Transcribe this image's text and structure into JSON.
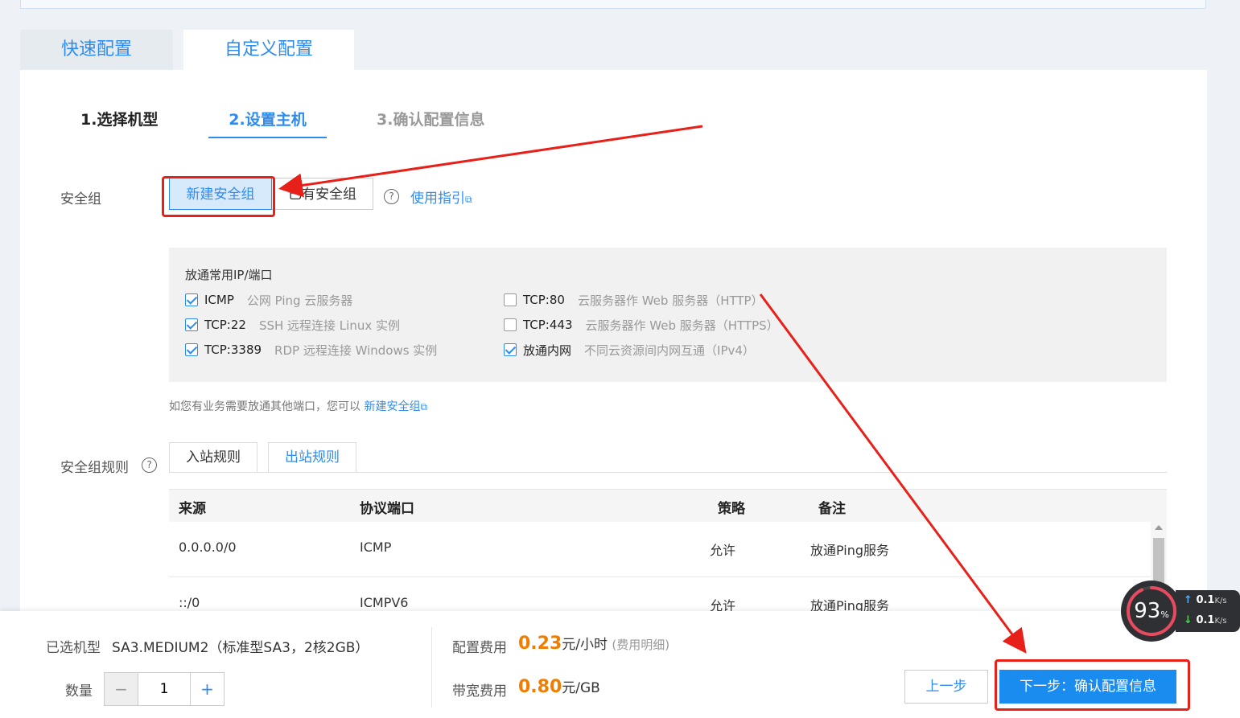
{
  "mode_tabs": {
    "quick": "快速配置",
    "custom": "自定义配置"
  },
  "steps": [
    "1.选择机型",
    "2.设置主机",
    "3.确认配置信息"
  ],
  "security_group": {
    "label": "安全组",
    "new_label": "新建安全组",
    "existing_label": "已有安全组",
    "guide_link": "使用指引"
  },
  "ports": {
    "title": "放通常用IP/端口",
    "items": [
      {
        "name": "ICMP",
        "desc": "公网 Ping 云服务器",
        "checked": true
      },
      {
        "name": "TCP:22",
        "desc": "SSH 远程连接 Linux 实例",
        "checked": true
      },
      {
        "name": "TCP:3389",
        "desc": "RDP 远程连接 Windows 实例",
        "checked": true
      },
      {
        "name": "TCP:80",
        "desc": "云服务器作 Web 服务器（HTTP）",
        "checked": false
      },
      {
        "name": "TCP:443",
        "desc": "云服务器作 Web 服务器（HTTPS）",
        "checked": false
      },
      {
        "name": "放通内网",
        "desc": "不同云资源间内网互通（IPv4）",
        "checked": true
      }
    ]
  },
  "hint": {
    "text": "如您有业务需要放通其他端口，您可以",
    "link": "新建安全组"
  },
  "rules": {
    "label": "安全组规则",
    "tab_in": "入站规则",
    "tab_out": "出站规则",
    "columns": [
      "来源",
      "协议端口",
      "策略",
      "备注"
    ],
    "rows": [
      {
        "source": "0.0.0.0/0",
        "protocol": "ICMP",
        "policy": "允许",
        "note": "放通Ping服务"
      },
      {
        "source": "::/0",
        "protocol": "ICMPV6",
        "policy": "允许",
        "note": "放通Ping服务"
      }
    ]
  },
  "footer": {
    "model_label": "已选机型",
    "model_value": "SA3.MEDIUM2（标准型SA3，2核2GB）",
    "qty_label": "数量",
    "qty_value": "1",
    "config_fee_label": "配置费用",
    "config_fee_price": "0.23",
    "config_fee_unit": "元/小时",
    "config_fee_detail": "(费用明细)",
    "bw_fee_label": "带宽费用",
    "bw_fee_price": "0.80",
    "bw_fee_unit": "元/GB",
    "prev_label": "上一步",
    "next_label": "下一步：确认配置信息"
  },
  "net_widget": {
    "percent": "93",
    "percent_unit": "%",
    "up": "0.1",
    "down": "0.1",
    "speed_unit": "K/s"
  },
  "colors": {
    "accent": "#2d8cf0",
    "price": "#f07d00",
    "annotation": "#e8201a"
  }
}
